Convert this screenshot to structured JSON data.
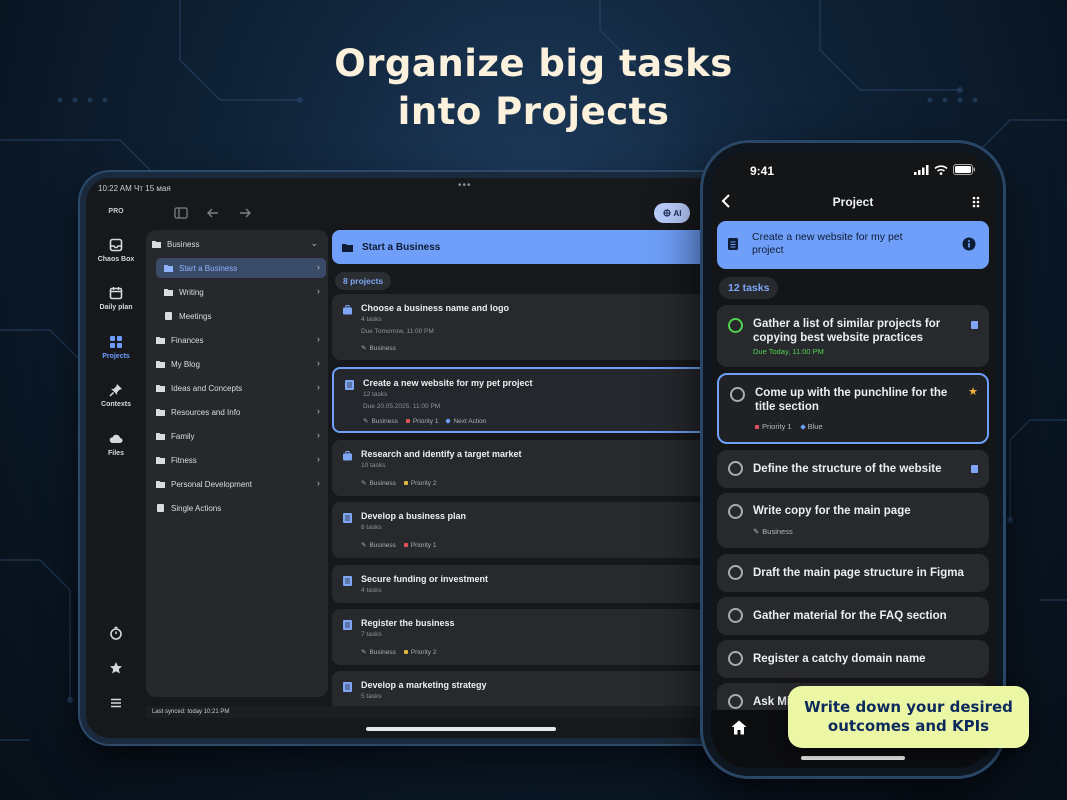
{
  "headline": {
    "line1": "Organize big tasks",
    "line2": "into Projects"
  },
  "tablet": {
    "status_time": "10:22 AM  Чт 15 мая",
    "badge": "PRO",
    "ai_label": "AI",
    "rail": [
      {
        "label": "Chaos Box",
        "icon": "inbox-icon"
      },
      {
        "label": "Daily plan",
        "icon": "calendar-icon"
      },
      {
        "label": "Projects",
        "icon": "grid-icon",
        "active": true
      },
      {
        "label": "Contexts",
        "icon": "pin-icon"
      },
      {
        "label": "Files",
        "icon": "cloud-icon"
      }
    ],
    "folders": [
      {
        "label": "Business"
      },
      {
        "label": "Start a Business"
      },
      {
        "label": "Writing"
      },
      {
        "label": "Meetings"
      },
      {
        "label": "Finances"
      },
      {
        "label": "My Blog"
      },
      {
        "label": "Ideas and Concepts"
      },
      {
        "label": "Resources and Info"
      },
      {
        "label": "Family"
      },
      {
        "label": "Fitness"
      },
      {
        "label": "Personal Development"
      },
      {
        "label": "Single Actions"
      }
    ],
    "header_title": "Start a Business",
    "project_count": "8 projects",
    "projects": [
      {
        "title": "Choose a business name and logo",
        "tasks": "4 tasks",
        "due": "Due Tomorrow, 11:00 PM",
        "tags": [
          "Business"
        ]
      },
      {
        "title": "Create a new website for my pet project",
        "tasks": "12 tasks",
        "due": "Due 20.05.2025, 11:00 PM",
        "tags": [
          "Business",
          "Priority 1",
          "Next Action"
        ]
      },
      {
        "title": "Research and identify a target market",
        "tasks": "10 tasks",
        "tags": [
          "Business",
          "Priority 2"
        ]
      },
      {
        "title": "Develop a business plan",
        "tasks": "6 tasks",
        "tags": [
          "Business",
          "Priority 1"
        ]
      },
      {
        "title": "Secure funding or investment",
        "tasks": "4 tasks"
      },
      {
        "title": "Register the business",
        "tasks": "7 tasks",
        "tags": [
          "Business",
          "Priority 2"
        ]
      },
      {
        "title": "Develop a marketing strategy",
        "tasks": "5 tasks"
      }
    ],
    "footer": "Last synced: today 10:21 PM"
  },
  "phone": {
    "time": "9:41",
    "nav_title": "Project",
    "project_title": "Create a new website for my pet project",
    "task_count": "12 tasks",
    "tasks": [
      {
        "title": "Gather a list of similar projects for copying best website practices",
        "due": "Due Today, 11:00 PM"
      },
      {
        "title": "Come up with the punchline for the title section",
        "tags": [
          "Priority 1",
          "Blue"
        ]
      },
      {
        "title": "Define the structure of the website"
      },
      {
        "title": "Write copy for the main page",
        "tags": [
          "Business"
        ]
      },
      {
        "title": "Draft the main page structure in Figma"
      },
      {
        "title": "Gather material for the FAQ section"
      },
      {
        "title": "Register a catchy domain name"
      },
      {
        "title": "Ask Mi"
      }
    ]
  },
  "callout": {
    "line1": "Write down your desired",
    "line2": "outcomes and KPIs"
  },
  "colors": {
    "accent": "#6f9ff8",
    "callout_bg": "#ecf7a6",
    "headline": "#fbf1dc",
    "done_green": "#4fd24f"
  }
}
